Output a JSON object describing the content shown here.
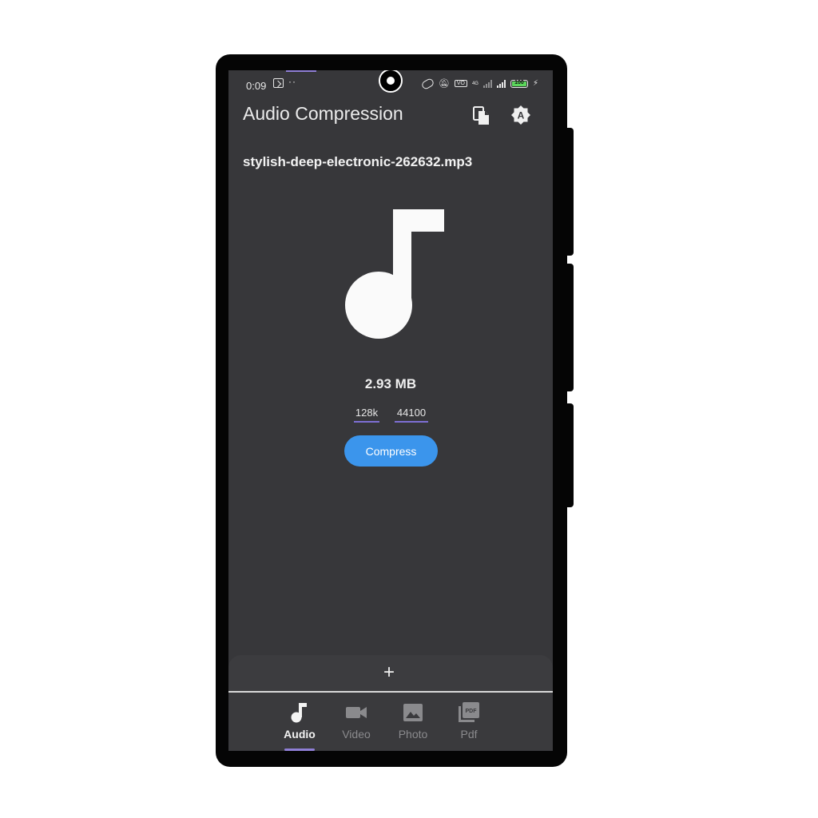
{
  "status_bar": {
    "time": "0:09",
    "dots": "··",
    "battery_level": 100,
    "battery_text": "100",
    "network": "4G"
  },
  "app_bar": {
    "title": "Audio Compression"
  },
  "file": {
    "name": "stylish-deep-electronic-262632.mp3",
    "size": "2.93 MB"
  },
  "params": {
    "bitrate": "128k",
    "sample_rate": "44100"
  },
  "actions": {
    "compress_label": "Compress",
    "add_label": "+"
  },
  "bottom_nav": {
    "items": [
      {
        "label": "Audio",
        "icon": "music-note-icon",
        "active": true
      },
      {
        "label": "Video",
        "icon": "videocam-icon",
        "active": false
      },
      {
        "label": "Photo",
        "icon": "image-icon",
        "active": false
      },
      {
        "label": "Pdf",
        "icon": "pdf-icon",
        "active": false
      }
    ]
  },
  "colors": {
    "background": "#37373a",
    "accent": "#3b95ec",
    "underline": "#7e6fd4",
    "nav_indicator": "#8f7fd6",
    "battery_fill": "#5bd65b"
  }
}
